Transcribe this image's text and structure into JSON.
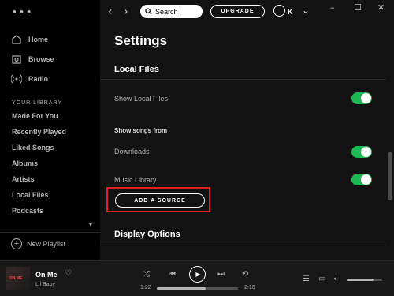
{
  "sidebar": {
    "nav": [
      {
        "label": "Home",
        "icon": "home-icon"
      },
      {
        "label": "Browse",
        "icon": "browse-icon"
      },
      {
        "label": "Radio",
        "icon": "radio-icon"
      }
    ],
    "library_title": "YOUR LIBRARY",
    "library_items": [
      "Made For You",
      "Recently Played",
      "Liked Songs",
      "Albums",
      "Artists",
      "Local Files",
      "Podcasts"
    ],
    "new_playlist": "New Playlist"
  },
  "topbar": {
    "search_label": "Search",
    "upgrade_label": "UPGRADE",
    "user_initial": "K"
  },
  "settings": {
    "title": "Settings",
    "local_files_title": "Local Files",
    "show_local_files": "Show Local Files",
    "show_local_files_on": true,
    "show_songs_from": "Show songs from",
    "sources": [
      {
        "label": "Downloads",
        "enabled": true
      },
      {
        "label": "Music Library",
        "enabled": true
      }
    ],
    "add_source": "ADD A SOURCE",
    "display_options_title": "Display Options"
  },
  "player": {
    "track_title": "On Me",
    "artist": "Lil Baby",
    "album_text": "ON ME",
    "elapsed": "1:22",
    "duration": "2:16",
    "progress": 0.6,
    "volume": 0.75
  },
  "colors": {
    "accent": "#1db954",
    "highlight": "#e02020",
    "background": "#121212"
  }
}
